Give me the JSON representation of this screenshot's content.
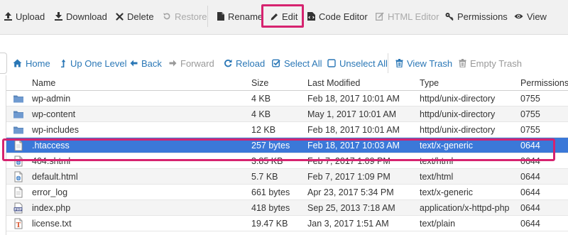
{
  "toolbar": {
    "upload": "Upload",
    "download": "Download",
    "delete": "Delete",
    "restore": "Restore",
    "rename": "Rename",
    "edit": "Edit",
    "code_editor": "Code Editor",
    "html_editor": "HTML Editor",
    "permissions": "Permissions",
    "view": "View"
  },
  "nav": {
    "home": "Home",
    "up_one_level": "Up One Level",
    "back": "Back",
    "forward": "Forward",
    "reload": "Reload",
    "select_all": "Select All",
    "unselect_all": "Unselect All",
    "view_trash": "View Trash",
    "empty_trash": "Empty Trash"
  },
  "table": {
    "columns": {
      "name": "Name",
      "size": "Size",
      "last_modified": "Last Modified",
      "type": "Type",
      "permissions": "Permissions"
    },
    "rows": [
      {
        "icon": "folder-icon",
        "name": "wp-admin",
        "size": "4 KB",
        "modified": "Feb 18, 2017 10:01 AM",
        "type": "httpd/unix-directory",
        "perm": "0755"
      },
      {
        "icon": "folder-icon",
        "name": "wp-content",
        "size": "4 KB",
        "modified": "May 1, 2017 10:01 AM",
        "type": "httpd/unix-directory",
        "perm": "0755"
      },
      {
        "icon": "folder-icon",
        "name": "wp-includes",
        "size": "12 KB",
        "modified": "Feb 18, 2017 10:01 AM",
        "type": "httpd/unix-directory",
        "perm": "0755"
      },
      {
        "icon": "text-file-icon",
        "name": ".htaccess",
        "size": "257 bytes",
        "modified": "Feb 18, 2017 10:03 AM",
        "type": "text/x-generic",
        "perm": "0644",
        "selected": true
      },
      {
        "icon": "html-file-icon",
        "name": "404.shtml",
        "size": "3.85 KB",
        "modified": "Feb 7, 2017 1:09 PM",
        "type": "text/html",
        "perm": "0644"
      },
      {
        "icon": "html-file-icon",
        "name": "default.html",
        "size": "5.7 KB",
        "modified": "Feb 7, 2017 1:09 PM",
        "type": "text/html",
        "perm": "0644"
      },
      {
        "icon": "text-file-icon",
        "name": "error_log",
        "size": "661 bytes",
        "modified": "Apr 23, 2017 5:34 PM",
        "type": "text/x-generic",
        "perm": "0644"
      },
      {
        "icon": "php-file-icon",
        "name": "index.php",
        "size": "418 bytes",
        "modified": "Sep 25, 2013 7:18 AM",
        "type": "application/x-httpd-php",
        "perm": "0644"
      },
      {
        "icon": "txt-file-icon",
        "name": "license.txt",
        "size": "19.47 KB",
        "modified": "Jan 3, 2017 1:51 AM",
        "type": "text/plain",
        "perm": "0644"
      }
    ]
  },
  "colors": {
    "selected_row": "#3b78d8",
    "highlight_box": "#d6236f",
    "link": "#2a77b6"
  }
}
